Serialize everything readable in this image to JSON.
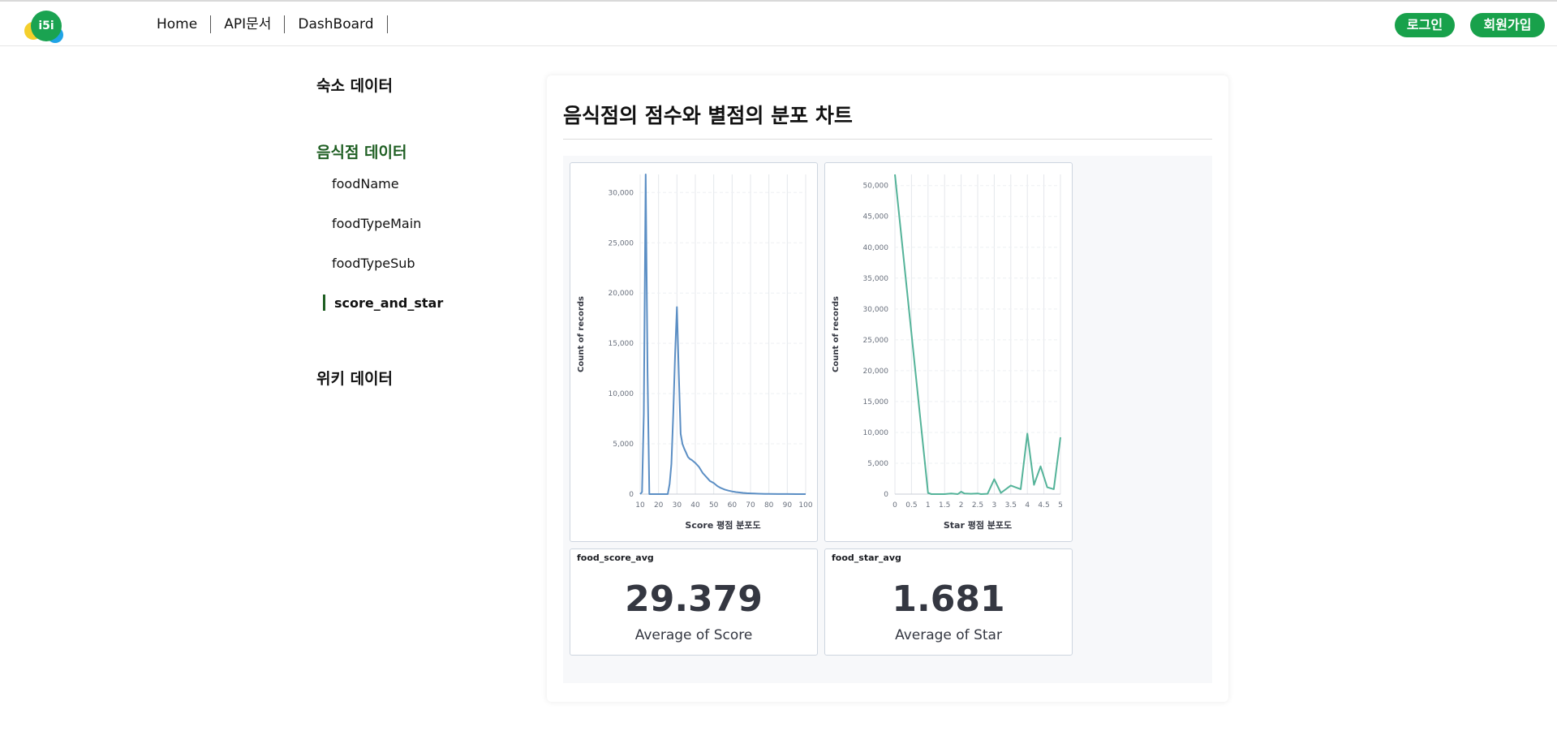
{
  "header": {
    "logo_text": "i5i",
    "nav": [
      "Home",
      "API문서",
      "DashBoard"
    ],
    "login": "로그인",
    "signup": "회원가입",
    "colors": {
      "brand": "#18a14b",
      "logo_yellow": "#f4cf2c",
      "logo_blue": "#1fa3e6"
    }
  },
  "sidebar": {
    "sections": [
      {
        "label": "숙소 데이터",
        "items": []
      },
      {
        "label": "음식점 데이터",
        "active": true,
        "items": [
          "foodName",
          "foodTypeMain",
          "foodTypeSub",
          "score_and_star"
        ],
        "selected": "score_and_star"
      },
      {
        "label": "위키 데이터",
        "items": []
      }
    ],
    "active_color": "#1f5f23"
  },
  "main": {
    "title": "음식점의 점수와 별점의 분포 차트",
    "metrics": [
      {
        "title": "food_score_avg",
        "value": "29.379",
        "label": "Average of Score"
      },
      {
        "title": "food_star_avg",
        "value": "1.681",
        "label": "Average of Star"
      }
    ]
  },
  "chart_data": [
    {
      "type": "line",
      "xlabel": "Score 평점 분포도",
      "ylabel": "Count of records",
      "xlim": [
        10,
        100
      ],
      "ylim": [
        0,
        31800
      ],
      "x_ticks": [
        10,
        20,
        30,
        40,
        50,
        60,
        70,
        80,
        90,
        100
      ],
      "y_ticks": [
        0,
        5000,
        10000,
        15000,
        20000,
        25000,
        30000
      ],
      "y_tick_labels": [
        "0",
        "5,000",
        "10,000",
        "15,000",
        "20,000",
        "25,000",
        "30,000"
      ],
      "grid": "vertical",
      "color": "#5b8ec4",
      "series": [
        {
          "x": [
            10,
            11,
            12,
            13,
            14,
            15,
            20,
            25,
            26,
            27,
            28,
            29,
            30,
            31,
            32,
            33,
            34,
            35,
            36,
            37,
            38,
            40,
            42,
            44,
            46,
            48,
            50,
            52,
            54,
            56,
            58,
            60,
            62,
            64,
            66,
            68,
            70,
            72,
            74,
            76,
            78,
            80,
            85,
            90,
            95,
            100
          ],
          "y": [
            0,
            200,
            8000,
            31800,
            12000,
            0,
            0,
            0,
            1000,
            3000,
            8000,
            14000,
            18600,
            12000,
            6000,
            5000,
            4500,
            4100,
            3700,
            3500,
            3400,
            3100,
            2700,
            2100,
            1700,
            1300,
            1100,
            800,
            600,
            450,
            350,
            270,
            200,
            160,
            120,
            90,
            70,
            55,
            40,
            30,
            20,
            15,
            8,
            5,
            2,
            0
          ]
        }
      ]
    },
    {
      "type": "line",
      "xlabel": "Star 평점 분포도",
      "ylabel": "Count of records",
      "xlim": [
        0,
        5
      ],
      "ylim": [
        0,
        51800
      ],
      "x_ticks": [
        0,
        0.5,
        1,
        1.5,
        2,
        2.5,
        3,
        3.5,
        4,
        4.5,
        5
      ],
      "y_ticks": [
        0,
        5000,
        10000,
        15000,
        20000,
        25000,
        30000,
        35000,
        40000,
        45000,
        50000
      ],
      "y_tick_labels": [
        "0",
        "5,000",
        "10,000",
        "15,000",
        "20,000",
        "25,000",
        "30,000",
        "35,000",
        "40,000",
        "45,000",
        "50,000"
      ],
      "grid": "vertical",
      "color": "#54b399",
      "series": [
        {
          "x": [
            0,
            1,
            1.1,
            1.2,
            1.5,
            1.7,
            1.8,
            1.9,
            2,
            2.1,
            2.3,
            2.5,
            2.6,
            2.8,
            3,
            3.2,
            3.5,
            3.8,
            4,
            4.2,
            4.4,
            4.6,
            4.8,
            5
          ],
          "y": [
            51800,
            200,
            0,
            0,
            0,
            100,
            50,
            0,
            400,
            100,
            50,
            100,
            0,
            50,
            2400,
            200,
            1400,
            800,
            9800,
            1500,
            4500,
            1100,
            800,
            9200
          ]
        }
      ]
    }
  ]
}
